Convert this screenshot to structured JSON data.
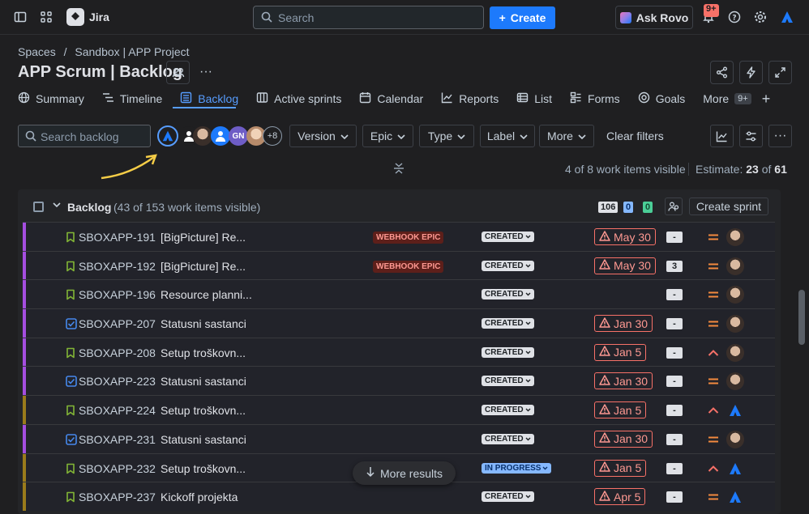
{
  "topbar": {
    "app_name": "Jira",
    "search_placeholder": "Search",
    "create_label": "Create",
    "rovo_label": "Ask Rovo",
    "notifications_badge": "9+"
  },
  "header": {
    "breadcrumb": [
      "Spaces",
      "/",
      "Sandbox | APP Project"
    ],
    "title": "APP Scrum | Backlog"
  },
  "tabs": [
    {
      "label": "Summary"
    },
    {
      "label": "Timeline"
    },
    {
      "label": "Backlog"
    },
    {
      "label": "Active sprints"
    },
    {
      "label": "Calendar"
    },
    {
      "label": "Reports"
    },
    {
      "label": "List"
    },
    {
      "label": "Forms"
    },
    {
      "label": "Goals"
    },
    {
      "label": "More",
      "count": "9+"
    }
  ],
  "filters": {
    "search_placeholder": "Search backlog",
    "avatar_initials": "GN",
    "more_avatars": "+8",
    "buttons": [
      "Version",
      "Epic",
      "Type",
      "Label",
      "More"
    ],
    "clear": "Clear filters"
  },
  "summary": {
    "visible": "4 of 8 work items visible",
    "estimate_label": "Estimate:",
    "estimate_value": "23",
    "estimate_of": "of",
    "estimate_total": "61"
  },
  "backlog": {
    "title": "Backlog",
    "subtitle": "(43 of 153 work items visible)",
    "counts": [
      "106",
      "0",
      "0"
    ],
    "create_sprint": "Create sprint",
    "rows": [
      {
        "key": "SBOXAPP-191",
        "summary": "[BigPicture] Re...",
        "epic": "WEBHOOK EPIC",
        "status": "CREATED",
        "due": "May 30",
        "estimate": "-",
        "type": "story",
        "priority": "medium",
        "bar": "#a54800",
        "assignee": "face"
      },
      {
        "key": "SBOXAPP-192",
        "summary": "[BigPicture] Re...",
        "epic": "WEBHOOK EPIC",
        "status": "CREATED",
        "due": "May 30",
        "estimate": "3",
        "type": "story",
        "priority": "medium",
        "bar": "#a54800",
        "assignee": "face"
      },
      {
        "key": "SBOXAPP-196",
        "summary": "Resource planni...",
        "epic": "",
        "status": "CREATED",
        "due": "",
        "estimate": "-",
        "type": "story",
        "priority": "medium",
        "bar": "#a54800",
        "assignee": "face"
      },
      {
        "key": "SBOXAPP-207",
        "summary": "Statusni sastanci",
        "epic": "",
        "status": "CREATED",
        "due": "Jan 30",
        "estimate": "-",
        "type": "task",
        "priority": "medium",
        "bar": "#a54800",
        "assignee": "face"
      },
      {
        "key": "SBOXAPP-208",
        "summary": "Setup troškovn...",
        "epic": "",
        "status": "CREATED",
        "due": "Jan 5",
        "estimate": "-",
        "type": "story",
        "priority": "high",
        "bar": "#a54800",
        "assignee": "face"
      },
      {
        "key": "SBOXAPP-223",
        "summary": "Statusni sastanci",
        "epic": "",
        "status": "CREATED",
        "due": "Jan 30",
        "estimate": "-",
        "type": "task",
        "priority": "medium",
        "bar": "#a54800",
        "assignee": "face"
      },
      {
        "key": "SBOXAPP-224",
        "summary": "Setup troškovn...",
        "epic": "",
        "status": "CREATED",
        "due": "Jan 5",
        "estimate": "-",
        "type": "story",
        "priority": "high",
        "bar": "#946f00",
        "assignee": "logo"
      },
      {
        "key": "SBOXAPP-231",
        "summary": "Statusni sastanci",
        "epic": "",
        "status": "CREATED",
        "due": "Jan 30",
        "estimate": "-",
        "type": "task",
        "priority": "medium",
        "bar": "#a54800",
        "assignee": "face"
      },
      {
        "key": "SBOXAPP-232",
        "summary": "Setup troškovn...",
        "epic": "",
        "status": "IN PROGRESS",
        "due": "Jan 5",
        "estimate": "-",
        "type": "story",
        "priority": "high",
        "bar": "#946f00",
        "assignee": "logo"
      },
      {
        "key": "SBOXAPP-237",
        "summary": "Kickoff projekta",
        "epic": "",
        "status": "CREATED",
        "due": "Apr 5",
        "estimate": "-",
        "type": "story",
        "priority": "medium",
        "bar": "#946f00",
        "assignee": "logo"
      }
    ]
  },
  "more_results": "More results",
  "colors": {
    "accent": "#1d7afc",
    "overdue": "#f87168",
    "purple_bar": "#a54800"
  }
}
